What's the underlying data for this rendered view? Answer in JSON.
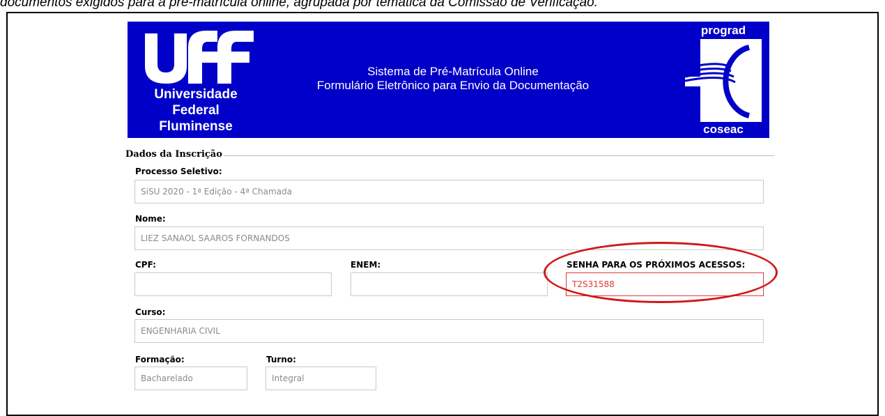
{
  "caption": "documentos exigidos para a pré-matrícula online, agrupada por temática da Comissão de Verificação.",
  "header": {
    "uff_name_lines": [
      "Universidade",
      "Federal",
      "Fluminense"
    ],
    "title_line1": "Sistema de Pré-Matrícula Online",
    "title_line2": "Formulário Eletrônico para Envio da Documentação",
    "prograd": "prograd",
    "coseac": "coseac"
  },
  "form": {
    "legend": "Dados da Inscrição",
    "processo_label": "Processo Seletivo:",
    "processo_value": "SiSU 2020 - 1ª Edição - 4ª Chamada",
    "nome_label": "Nome:",
    "nome_value": "LIEZ SANAOL SAAROS FORNANDOS",
    "cpf_label": "CPF:",
    "cpf_value": "",
    "enem_label": "ENEM:",
    "enem_value": "",
    "senha_label": "SENHA PARA OS PRÓXIMOS ACESSOS:",
    "senha_value": "T2S31588",
    "curso_label": "Curso:",
    "curso_value": "ENGENHARIA CIVIL",
    "formacao_label": "Formação:",
    "formacao_value": "Bacharelado",
    "turno_label": "Turno:",
    "turno_value": "Integral"
  },
  "colors": {
    "banner": "#0000c8",
    "highlight": "#d01818"
  }
}
